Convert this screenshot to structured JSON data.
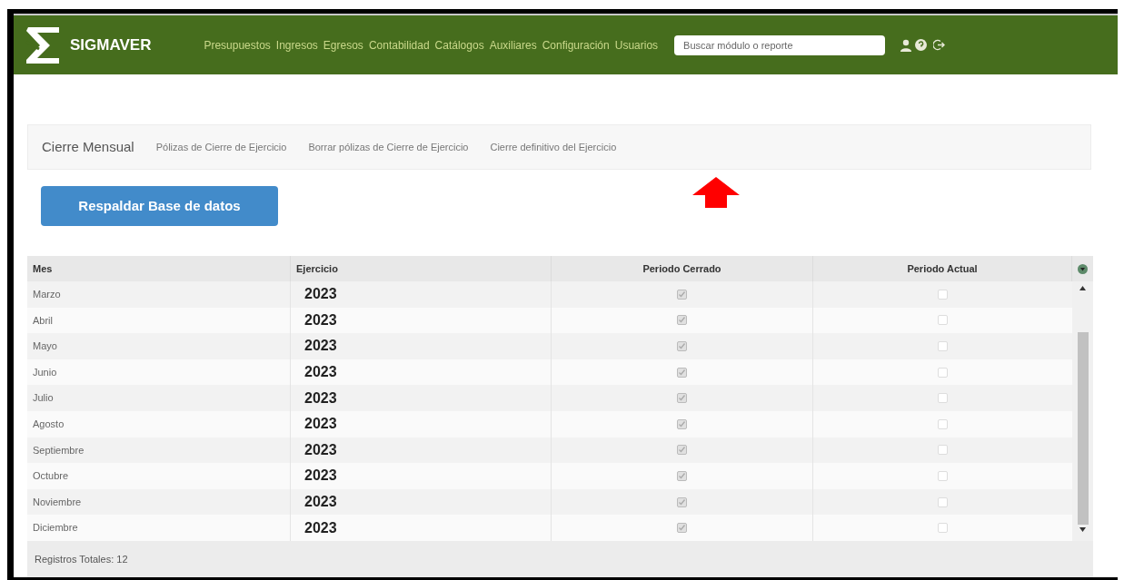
{
  "header": {
    "brand": "SIGMAVER",
    "menu": [
      "Presupuestos",
      "Ingresos",
      "Egresos",
      "Contabilidad",
      "Catálogos",
      "Auxiliares",
      "Configuración",
      "Usuarios"
    ],
    "search": {
      "placeholder": "Buscar módulo o reporte"
    }
  },
  "tabs": [
    {
      "label": "Cierre Mensual",
      "selected": true
    },
    {
      "label": "Pólizas de Cierre de Ejercicio",
      "selected": false
    },
    {
      "label": "Borrar pólizas de Cierre de Ejercicio",
      "selected": false
    },
    {
      "label": "Cierre definitivo del Ejercicio",
      "selected": false
    }
  ],
  "backup_button": "Respaldar Base de datos",
  "table": {
    "columns": [
      "Mes",
      "Ejercicio",
      "Periodo Cerrado",
      "Periodo Actual"
    ],
    "rows": [
      {
        "mes": "Marzo",
        "ejercicio": "2023",
        "cerrado": true,
        "actual": false
      },
      {
        "mes": "Abril",
        "ejercicio": "2023",
        "cerrado": true,
        "actual": false
      },
      {
        "mes": "Mayo",
        "ejercicio": "2023",
        "cerrado": true,
        "actual": false
      },
      {
        "mes": "Junio",
        "ejercicio": "2023",
        "cerrado": true,
        "actual": false
      },
      {
        "mes": "Julio",
        "ejercicio": "2023",
        "cerrado": true,
        "actual": false
      },
      {
        "mes": "Agosto",
        "ejercicio": "2023",
        "cerrado": true,
        "actual": false
      },
      {
        "mes": "Septiembre",
        "ejercicio": "2023",
        "cerrado": true,
        "actual": false
      },
      {
        "mes": "Octubre",
        "ejercicio": "2023",
        "cerrado": true,
        "actual": false
      },
      {
        "mes": "Noviembre",
        "ejercicio": "2023",
        "cerrado": true,
        "actual": false
      },
      {
        "mes": "Diciembre",
        "ejercicio": "2023",
        "cerrado": true,
        "actual": false
      }
    ],
    "footer": "Registros Totales: 12"
  }
}
